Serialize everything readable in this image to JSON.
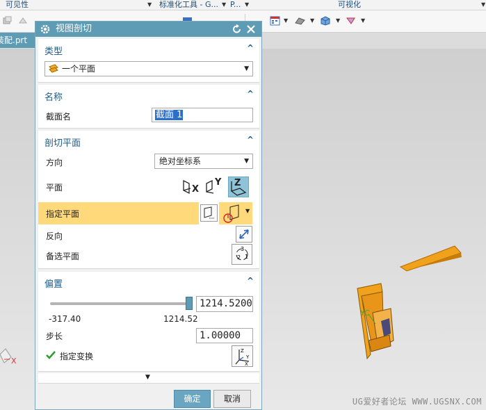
{
  "ribbon": {
    "group1": "可见性",
    "group2": "标准化工具 - G...",
    "group3": "P...",
    "group4": "可视化"
  },
  "file_tab": "装配.prt",
  "dialog": {
    "title": "视图剖切",
    "type_section": {
      "heading": "类型",
      "value": "一个平面"
    },
    "name_section": {
      "heading": "名称",
      "label": "截面名",
      "value": "截面 1"
    },
    "plane_section": {
      "heading": "剖切平面",
      "direction_label": "方向",
      "direction_value": "绝对坐标系",
      "plane_label": "平面",
      "axis_x": "X",
      "axis_y": "Y",
      "axis_z": "Z",
      "specify_plane_label": "指定平面",
      "reverse_label": "反向",
      "alternate_label": "备选平面"
    },
    "offset_section": {
      "heading": "偏置",
      "value": "1214.5200",
      "slider_fraction": 1.0,
      "min_label": "-317.40",
      "max_label": "1214.52",
      "step_label": "步长",
      "step_value": "1.00000",
      "transform_label": "指定变换"
    },
    "ok_label": "确定",
    "cancel_label": "取消"
  },
  "viewport": {
    "axis_label_x": "X",
    "axis_label_yc": "YC",
    "watermark": "UG爱好者论坛 WWW.UGSNX.COM"
  },
  "colors": {
    "title_bar": "#5e9bb4",
    "highlight": "#ffd97a",
    "model": "#f0a21c"
  }
}
